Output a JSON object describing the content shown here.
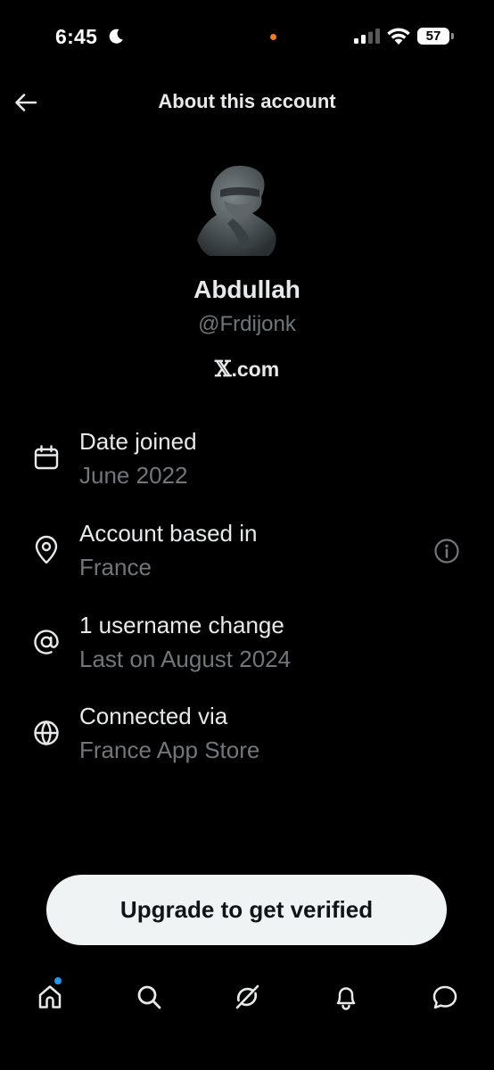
{
  "status_bar": {
    "time": "6:45",
    "battery": "57",
    "icons": [
      "moon-icon",
      "signal-icon",
      "wifi-icon",
      "battery-icon"
    ],
    "indicator_color": "#f07a25"
  },
  "header": {
    "title": "About this account",
    "back_icon": "arrow-left-icon"
  },
  "profile": {
    "display_name": "Abdullah",
    "handle": "@Frdijonk",
    "site_mark": "𝕏",
    "site_suffix": ".com"
  },
  "info_rows": [
    {
      "icon": "calendar-icon",
      "title": "Date joined",
      "value": "June 2022"
    },
    {
      "icon": "location-pin-icon",
      "title": "Account based in",
      "value": "France",
      "extra_icon": "info-icon"
    },
    {
      "icon": "at-sign-icon",
      "title": "1 username change",
      "value": "Last on August 2024"
    },
    {
      "icon": "globe-icon",
      "title": "Connected via",
      "value": "France App Store"
    }
  ],
  "actions": {
    "upgrade_label": "Upgrade to get verified"
  },
  "bottom_nav": {
    "items": [
      "home-icon",
      "search-icon",
      "grok-icon",
      "notifications-icon",
      "messages-icon"
    ],
    "notification_dot_color": "#1d9bf0"
  },
  "colors": {
    "background": "#000000",
    "primary_text": "#e7e9ea",
    "secondary_text": "#71767b",
    "button_bg": "#eff3f4",
    "button_text": "#0f1419",
    "accent": "#1d9bf0"
  }
}
